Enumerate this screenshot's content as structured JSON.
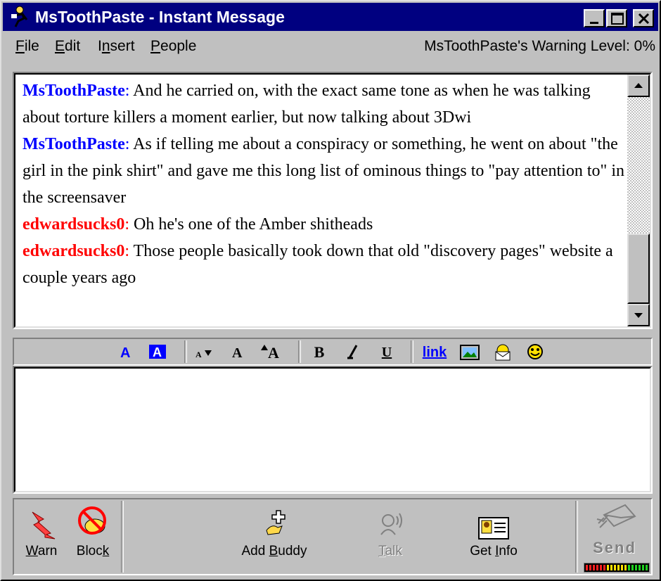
{
  "window": {
    "title": "MsToothPaste - Instant Message"
  },
  "menu": {
    "items": [
      {
        "u": "F",
        "rest": "ile"
      },
      {
        "u": "E",
        "rest": "dit"
      },
      {
        "pre": "I",
        "u": "n",
        "rest": "sert"
      },
      {
        "u": "P",
        "rest": "eople"
      }
    ],
    "warning": "MsToothPaste's Warning Level: 0%"
  },
  "conversation": {
    "messages": [
      {
        "sender": "MsToothPaste",
        "type": "me",
        "text": "And he carried on, with the exact same tone as when he was talking about torture killers a moment earlier, but now talking about 3Dwi"
      },
      {
        "sender": "MsToothPaste",
        "type": "me",
        "text": "As if telling me about a conspiracy or something, he went on about \"the girl in the pink shirt\" and gave me this long list of ominous things to \"pay attention to\" in the screensaver"
      },
      {
        "sender": "edwardsucks0",
        "type": "other",
        "text": "Oh he's one of the Amber shitheads"
      },
      {
        "sender": "edwardsucks0",
        "type": "other",
        "text": "Those people basically took down that old \"discovery pages\" website a couple years ago"
      }
    ]
  },
  "format_toolbar": {
    "link_label": "link",
    "bold": "B",
    "underline": "U",
    "font_a": "A"
  },
  "input": {
    "value": ""
  },
  "actions": {
    "warn": {
      "u": "W",
      "rest": "arn"
    },
    "block": {
      "pre": "Bloc",
      "u": "k",
      "rest": ""
    },
    "add_buddy": {
      "pre": "Add ",
      "u": "B",
      "rest": "uddy"
    },
    "talk": {
      "pre": "",
      "u": "T",
      "rest": "alk"
    },
    "get_info": {
      "pre": "Get ",
      "u": "I",
      "rest": "nfo"
    },
    "send": "Send"
  },
  "colors": {
    "title_bar": "#000080",
    "me": "#0000ff",
    "other": "#ff0000",
    "face": "#c0c0c0"
  }
}
